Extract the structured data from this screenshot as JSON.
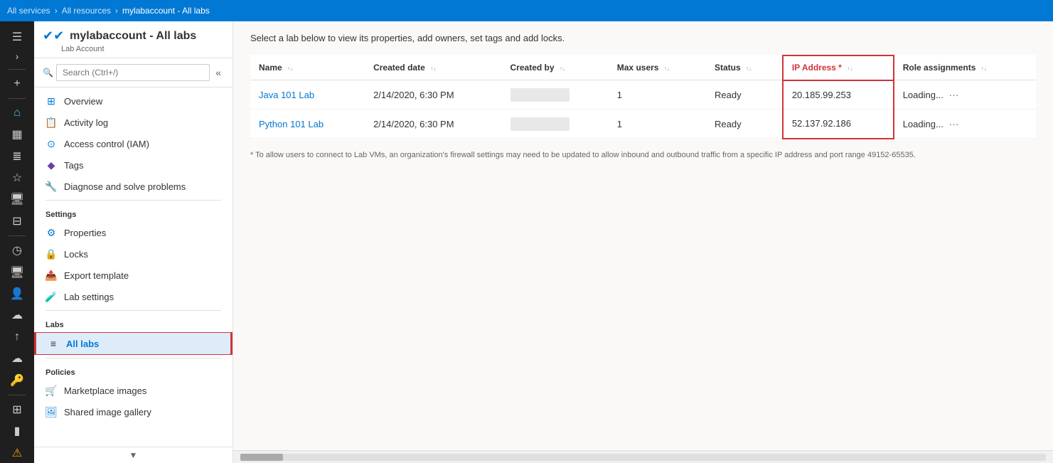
{
  "topbar": {
    "breadcrumbs": [
      {
        "label": "All services",
        "link": true
      },
      {
        "label": "All resources",
        "link": true
      },
      {
        "label": "mylabaccount - All labs",
        "link": false
      }
    ],
    "separator": ">"
  },
  "sidebar": {
    "title": "mylabaccount - All labs",
    "subtitle": "Lab Account",
    "search_placeholder": "Search (Ctrl+/)",
    "collapse_icon": "«",
    "nav_items": [
      {
        "id": "overview",
        "label": "Overview",
        "icon": "⊞",
        "section": null
      },
      {
        "id": "activity-log",
        "label": "Activity log",
        "icon": "📋",
        "section": null
      },
      {
        "id": "access-control",
        "label": "Access control (IAM)",
        "icon": "👤",
        "section": null
      },
      {
        "id": "tags",
        "label": "Tags",
        "icon": "🏷",
        "section": null
      },
      {
        "id": "diagnose",
        "label": "Diagnose and solve problems",
        "icon": "🔧",
        "section": null
      },
      {
        "id": "settings-header",
        "label": "Settings",
        "type": "section"
      },
      {
        "id": "properties",
        "label": "Properties",
        "icon": "⚙",
        "section": "Settings"
      },
      {
        "id": "locks",
        "label": "Locks",
        "icon": "🔒",
        "section": "Settings"
      },
      {
        "id": "export-template",
        "label": "Export template",
        "icon": "📤",
        "section": "Settings"
      },
      {
        "id": "lab-settings",
        "label": "Lab settings",
        "icon": "🧪",
        "section": "Settings"
      },
      {
        "id": "labs-header",
        "label": "Labs",
        "type": "section"
      },
      {
        "id": "all-labs",
        "label": "All labs",
        "icon": "≡",
        "section": "Labs",
        "active": true
      },
      {
        "id": "policies-header",
        "label": "Policies",
        "type": "section"
      },
      {
        "id": "marketplace-images",
        "label": "Marketplace images",
        "icon": "🛒",
        "section": "Policies"
      },
      {
        "id": "shared-image-gallery",
        "label": "Shared image gallery",
        "icon": "🖼",
        "section": "Policies"
      }
    ]
  },
  "content": {
    "description": "Select a lab below to view its properties, add owners, set tags and add locks.",
    "table": {
      "columns": [
        {
          "id": "name",
          "label": "Name",
          "sortable": true
        },
        {
          "id": "created_date",
          "label": "Created date",
          "sortable": true
        },
        {
          "id": "created_by",
          "label": "Created by",
          "sortable": true
        },
        {
          "id": "max_users",
          "label": "Max users",
          "sortable": true
        },
        {
          "id": "status",
          "label": "Status",
          "sortable": true
        },
        {
          "id": "ip_address",
          "label": "IP Address *",
          "sortable": true,
          "highlighted": true
        },
        {
          "id": "role_assignments",
          "label": "Role assignments",
          "sortable": true
        }
      ],
      "rows": [
        {
          "name": "Java 101 Lab",
          "created_date": "2/14/2020, 6:30 PM",
          "created_by": "REDACTED",
          "max_users": "1",
          "status": "Ready",
          "ip_address": "20.185.99.253",
          "role_assignments": "Loading..."
        },
        {
          "name": "Python 101 Lab",
          "created_date": "2/14/2020, 6:30 PM",
          "created_by": "REDACTED",
          "max_users": "1",
          "status": "Ready",
          "ip_address": "52.137.92.186",
          "role_assignments": "Loading..."
        }
      ],
      "footnote": "* To allow users to connect to Lab VMs, an organization's firewall settings may need to be updated to allow inbound and outbound traffic from a specific IP address and port range 49152-65535."
    }
  },
  "icons": {
    "expand": "›",
    "collapse": "«",
    "sort_up": "↑",
    "sort_down": "↓",
    "ellipsis": "···",
    "add": "+",
    "overview": "⊞",
    "activity_log": "≣",
    "access_control": "⊙",
    "tags": "◆",
    "diagnose": "🔧",
    "properties": "⚙",
    "locks": "🔒",
    "export": "⬆",
    "lab_settings": "⚗",
    "all_labs": "≡",
    "marketplace": "🛒",
    "shared_gallery": "🖼"
  }
}
